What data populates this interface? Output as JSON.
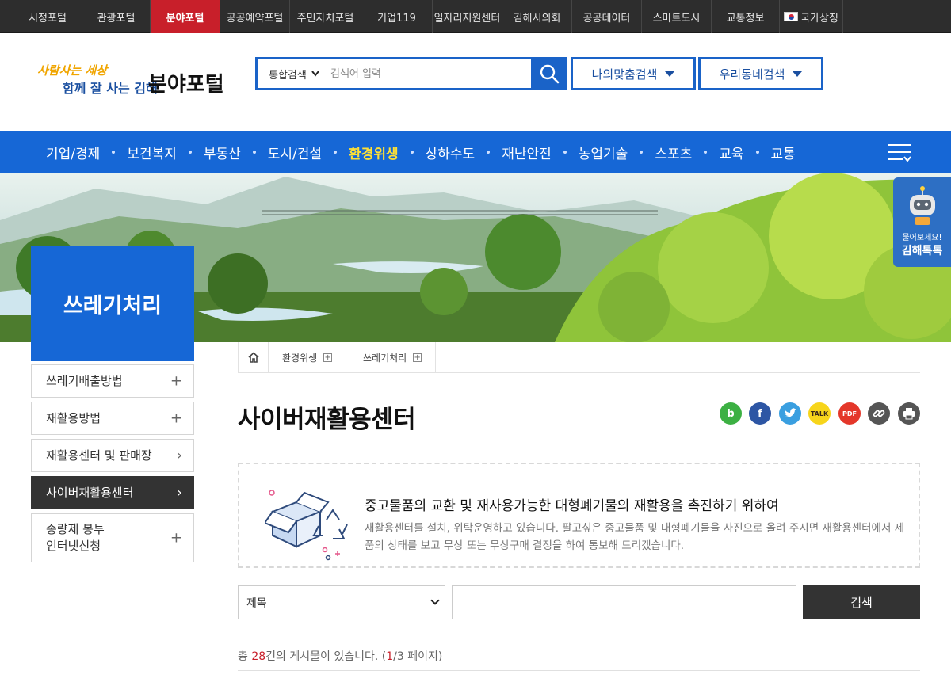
{
  "topbar": {
    "items": [
      {
        "label": "시정포털"
      },
      {
        "label": "관광포털"
      },
      {
        "label": "분야포털"
      },
      {
        "label": "공공예약포털"
      },
      {
        "label": "주민자치포털"
      },
      {
        "label": "기업119"
      },
      {
        "label": "일자리지원센터"
      },
      {
        "label": "김해시의회"
      },
      {
        "label": "공공데이터"
      },
      {
        "label": "스마트도시"
      },
      {
        "label": "교통정보"
      },
      {
        "label": "국가상징"
      }
    ],
    "active_index": 2,
    "active_color": "#c81f2a"
  },
  "logo": {
    "slogan": "사람사는 세상",
    "sub": "함께 잘 사는 김해",
    "name": "분야포털"
  },
  "search": {
    "scope": "통합검색",
    "placeholder": "검색어 입력",
    "my_search": "나의맞춤검색",
    "local_search": "우리동네검색"
  },
  "nav": {
    "items": [
      "기업/경제",
      "보건복지",
      "부동산",
      "도시/건설",
      "환경위생",
      "상하수도",
      "재난안전",
      "농업기술",
      "스포츠",
      "교육",
      "교통"
    ],
    "active_index": 4,
    "active_color": "#ffe135",
    "bg_color": "#1667d6"
  },
  "category": "쓰레기처리",
  "talk": {
    "line1": "물어보세요!",
    "line2": "김해톡톡"
  },
  "side_menu": [
    {
      "label": "쓰레기배출방법",
      "icon": "plus-icon"
    },
    {
      "label": "재활용방법",
      "icon": "plus-icon"
    },
    {
      "label": "재활용센터 및 판매장",
      "icon": "chevron-right-icon"
    },
    {
      "label": "사이버재활용센터",
      "icon": "chevron-right-icon",
      "active": true
    },
    {
      "label": "종량제 봉투\n인터넷신청",
      "icon": "plus-icon"
    }
  ],
  "breadcrumb": [
    "환경위생",
    "쓰레기처리"
  ],
  "page_title": "사이버재활용센터",
  "intro": {
    "heading": "중고물품의 교환 및 재사용가능한 대형폐기물의 재활용을 촉진하기 위하여",
    "body": "재활용센터를 설치, 위탁운영하고 있습니다. 팔고싶은 중고물품 및 대형폐기물을 사진으로 올려 주시면 재활용센터에서 제품의 상태를 보고 무상 또는 무상구매 결정을 하여 통보해 드리겠습니다."
  },
  "board_search": {
    "field": "제목",
    "button": "검색"
  },
  "total": {
    "prefix": "총 ",
    "count": "28",
    "mid": "건의 게시물이 있습니다. (",
    "page": "1",
    "suffix": "/3 페이지)"
  }
}
